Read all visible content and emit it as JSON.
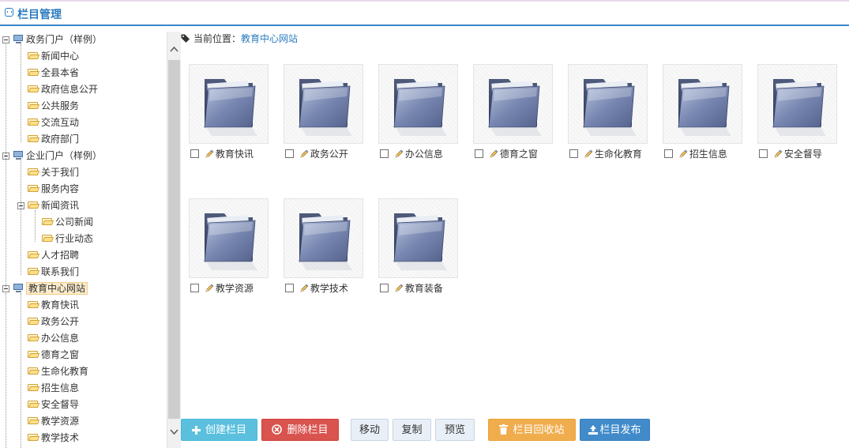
{
  "header": {
    "title": "栏目管理",
    "icon": "column-manage-icon"
  },
  "tree": {
    "items": [
      {
        "label": "政务门户（样例）",
        "kind": "root",
        "level": 0,
        "expanded": true
      },
      {
        "label": "新闻中心",
        "kind": "folder",
        "level": 1
      },
      {
        "label": "全县本省",
        "kind": "folder",
        "level": 1
      },
      {
        "label": "政府信息公开",
        "kind": "folder",
        "level": 1
      },
      {
        "label": "公共服务",
        "kind": "folder",
        "level": 1
      },
      {
        "label": "交流互动",
        "kind": "folder",
        "level": 1
      },
      {
        "label": "政府部门",
        "kind": "folder",
        "level": 1
      },
      {
        "label": "企业门户（样例）",
        "kind": "root",
        "level": 0,
        "expanded": true
      },
      {
        "label": "关于我们",
        "kind": "folder",
        "level": 1
      },
      {
        "label": "服务内容",
        "kind": "folder",
        "level": 1
      },
      {
        "label": "新闻资讯",
        "kind": "folder",
        "level": 1,
        "expanded": true
      },
      {
        "label": "公司新闻",
        "kind": "folder",
        "level": 2
      },
      {
        "label": "行业动态",
        "kind": "folder",
        "level": 2
      },
      {
        "label": "人才招聘",
        "kind": "folder",
        "level": 1
      },
      {
        "label": "联系我们",
        "kind": "folder",
        "level": 1
      },
      {
        "label": "教育中心网站",
        "kind": "root",
        "level": 0,
        "expanded": true,
        "selected": true
      },
      {
        "label": "教育快讯",
        "kind": "folder",
        "level": 1
      },
      {
        "label": "政务公开",
        "kind": "folder",
        "level": 1
      },
      {
        "label": "办公信息",
        "kind": "folder",
        "level": 1
      },
      {
        "label": "德育之窗",
        "kind": "folder",
        "level": 1
      },
      {
        "label": "生命化教育",
        "kind": "folder",
        "level": 1
      },
      {
        "label": "招生信息",
        "kind": "folder",
        "level": 1
      },
      {
        "label": "安全督导",
        "kind": "folder",
        "level": 1
      },
      {
        "label": "教学资源",
        "kind": "folder",
        "level": 1
      },
      {
        "label": "教学技术",
        "kind": "folder",
        "level": 1
      }
    ]
  },
  "breadcrumb": {
    "prefix": "当前位置：",
    "current": "教育中心网站"
  },
  "folders": [
    {
      "label": "教育快讯"
    },
    {
      "label": "政务公开"
    },
    {
      "label": "办公信息"
    },
    {
      "label": "德育之窗"
    },
    {
      "label": "生命化教育"
    },
    {
      "label": "招生信息"
    },
    {
      "label": "安全督导"
    },
    {
      "label": "教学资源"
    },
    {
      "label": "教学技术"
    },
    {
      "label": "教育装备"
    }
  ],
  "toolbar": {
    "create": "创建栏目",
    "delete": "删除栏目",
    "move": "移动",
    "copy": "复制",
    "preview": "预览",
    "recycle": "栏目回收站",
    "publish": "栏目发布"
  },
  "colors": {
    "accent": "#2b7bc0",
    "create": "#5bc0de",
    "delete": "#d9534f",
    "recycle": "#f0ad4e",
    "publish": "#428bca",
    "selected_bg": "#fbeccb"
  }
}
